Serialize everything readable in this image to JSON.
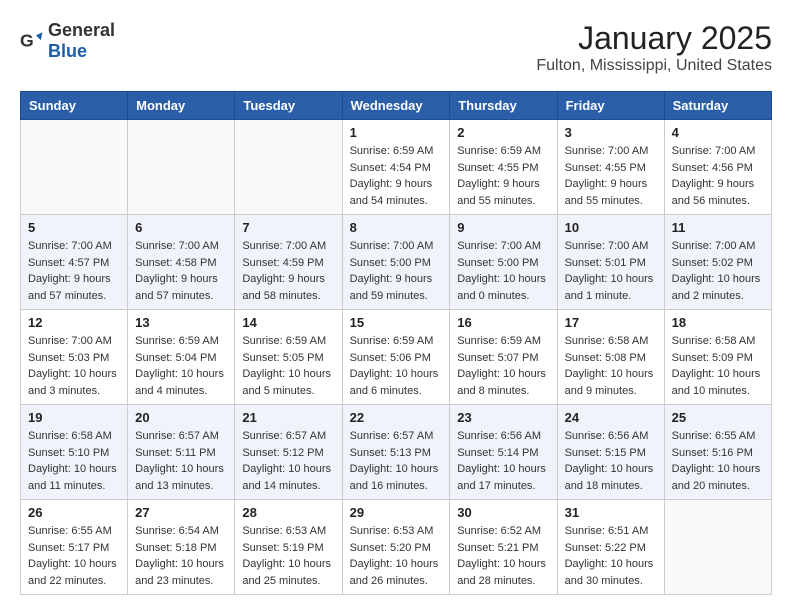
{
  "header": {
    "logo_general": "General",
    "logo_blue": "Blue",
    "month": "January 2025",
    "location": "Fulton, Mississippi, United States"
  },
  "weekdays": [
    "Sunday",
    "Monday",
    "Tuesday",
    "Wednesday",
    "Thursday",
    "Friday",
    "Saturday"
  ],
  "weeks": [
    [
      {
        "day": "",
        "info": ""
      },
      {
        "day": "",
        "info": ""
      },
      {
        "day": "",
        "info": ""
      },
      {
        "day": "1",
        "info": "Sunrise: 6:59 AM\nSunset: 4:54 PM\nDaylight: 9 hours\nand 54 minutes."
      },
      {
        "day": "2",
        "info": "Sunrise: 6:59 AM\nSunset: 4:55 PM\nDaylight: 9 hours\nand 55 minutes."
      },
      {
        "day": "3",
        "info": "Sunrise: 7:00 AM\nSunset: 4:55 PM\nDaylight: 9 hours\nand 55 minutes."
      },
      {
        "day": "4",
        "info": "Sunrise: 7:00 AM\nSunset: 4:56 PM\nDaylight: 9 hours\nand 56 minutes."
      }
    ],
    [
      {
        "day": "5",
        "info": "Sunrise: 7:00 AM\nSunset: 4:57 PM\nDaylight: 9 hours\nand 57 minutes."
      },
      {
        "day": "6",
        "info": "Sunrise: 7:00 AM\nSunset: 4:58 PM\nDaylight: 9 hours\nand 57 minutes."
      },
      {
        "day": "7",
        "info": "Sunrise: 7:00 AM\nSunset: 4:59 PM\nDaylight: 9 hours\nand 58 minutes."
      },
      {
        "day": "8",
        "info": "Sunrise: 7:00 AM\nSunset: 5:00 PM\nDaylight: 9 hours\nand 59 minutes."
      },
      {
        "day": "9",
        "info": "Sunrise: 7:00 AM\nSunset: 5:00 PM\nDaylight: 10 hours\nand 0 minutes."
      },
      {
        "day": "10",
        "info": "Sunrise: 7:00 AM\nSunset: 5:01 PM\nDaylight: 10 hours\nand 1 minute."
      },
      {
        "day": "11",
        "info": "Sunrise: 7:00 AM\nSunset: 5:02 PM\nDaylight: 10 hours\nand 2 minutes."
      }
    ],
    [
      {
        "day": "12",
        "info": "Sunrise: 7:00 AM\nSunset: 5:03 PM\nDaylight: 10 hours\nand 3 minutes."
      },
      {
        "day": "13",
        "info": "Sunrise: 6:59 AM\nSunset: 5:04 PM\nDaylight: 10 hours\nand 4 minutes."
      },
      {
        "day": "14",
        "info": "Sunrise: 6:59 AM\nSunset: 5:05 PM\nDaylight: 10 hours\nand 5 minutes."
      },
      {
        "day": "15",
        "info": "Sunrise: 6:59 AM\nSunset: 5:06 PM\nDaylight: 10 hours\nand 6 minutes."
      },
      {
        "day": "16",
        "info": "Sunrise: 6:59 AM\nSunset: 5:07 PM\nDaylight: 10 hours\nand 8 minutes."
      },
      {
        "day": "17",
        "info": "Sunrise: 6:58 AM\nSunset: 5:08 PM\nDaylight: 10 hours\nand 9 minutes."
      },
      {
        "day": "18",
        "info": "Sunrise: 6:58 AM\nSunset: 5:09 PM\nDaylight: 10 hours\nand 10 minutes."
      }
    ],
    [
      {
        "day": "19",
        "info": "Sunrise: 6:58 AM\nSunset: 5:10 PM\nDaylight: 10 hours\nand 11 minutes."
      },
      {
        "day": "20",
        "info": "Sunrise: 6:57 AM\nSunset: 5:11 PM\nDaylight: 10 hours\nand 13 minutes."
      },
      {
        "day": "21",
        "info": "Sunrise: 6:57 AM\nSunset: 5:12 PM\nDaylight: 10 hours\nand 14 minutes."
      },
      {
        "day": "22",
        "info": "Sunrise: 6:57 AM\nSunset: 5:13 PM\nDaylight: 10 hours\nand 16 minutes."
      },
      {
        "day": "23",
        "info": "Sunrise: 6:56 AM\nSunset: 5:14 PM\nDaylight: 10 hours\nand 17 minutes."
      },
      {
        "day": "24",
        "info": "Sunrise: 6:56 AM\nSunset: 5:15 PM\nDaylight: 10 hours\nand 18 minutes."
      },
      {
        "day": "25",
        "info": "Sunrise: 6:55 AM\nSunset: 5:16 PM\nDaylight: 10 hours\nand 20 minutes."
      }
    ],
    [
      {
        "day": "26",
        "info": "Sunrise: 6:55 AM\nSunset: 5:17 PM\nDaylight: 10 hours\nand 22 minutes."
      },
      {
        "day": "27",
        "info": "Sunrise: 6:54 AM\nSunset: 5:18 PM\nDaylight: 10 hours\nand 23 minutes."
      },
      {
        "day": "28",
        "info": "Sunrise: 6:53 AM\nSunset: 5:19 PM\nDaylight: 10 hours\nand 25 minutes."
      },
      {
        "day": "29",
        "info": "Sunrise: 6:53 AM\nSunset: 5:20 PM\nDaylight: 10 hours\nand 26 minutes."
      },
      {
        "day": "30",
        "info": "Sunrise: 6:52 AM\nSunset: 5:21 PM\nDaylight: 10 hours\nand 28 minutes."
      },
      {
        "day": "31",
        "info": "Sunrise: 6:51 AM\nSunset: 5:22 PM\nDaylight: 10 hours\nand 30 minutes."
      },
      {
        "day": "",
        "info": ""
      }
    ]
  ]
}
